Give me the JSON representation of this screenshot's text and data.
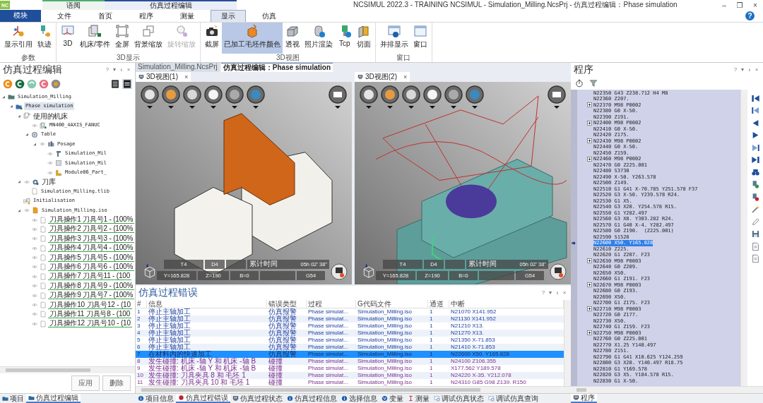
{
  "app": {
    "logo": "NC",
    "title": "NCSIMUL 2022.3 - TRAINING NCSIMUL - Simulation_Milling.NcsPrj - 仿真过程编辑：Phase simulation",
    "controls": [
      "–",
      "❐",
      "×"
    ],
    "help": "?"
  },
  "context_groups": [
    {
      "label": "语阅",
      "color": "#4caf70"
    },
    {
      "label": "仿真过程编辑",
      "color": "#2b4c9b"
    }
  ],
  "module_button": "模块",
  "ribbon_tabs": [
    {
      "label": "文件",
      "selected": false
    },
    {
      "label": "首页",
      "selected": false
    },
    {
      "label": "程序",
      "selected": false
    },
    {
      "label": "测量",
      "selected": false
    },
    {
      "label": "显示",
      "selected": true
    },
    {
      "label": "仿真",
      "selected": false
    }
  ],
  "ribbon_groups": [
    {
      "label": "参数",
      "buttons": [
        {
          "label": "显示引用",
          "kind": "axes",
          "selected": false,
          "disabled": false
        },
        {
          "label": "轨迹",
          "kind": "toolpath",
          "selected": false,
          "disabled": false
        }
      ]
    },
    {
      "label": "3D显示",
      "buttons": [
        {
          "label": "3D",
          "kind": "view3d",
          "selected": false,
          "disabled": false
        },
        {
          "label": "机床/零件",
          "kind": "machine",
          "selected": false,
          "disabled": false
        },
        {
          "label": "全屏",
          "kind": "fullscreen",
          "selected": false,
          "disabled": false
        },
        {
          "label": "背景缩放",
          "kind": "bgzoom",
          "selected": false,
          "disabled": false
        },
        {
          "label": "旋转缩放",
          "kind": "rotzoom",
          "selected": false,
          "disabled": true
        }
      ]
    },
    {
      "label": "3D视图",
      "buttons": [
        {
          "label": "截屏",
          "kind": "camera",
          "selected": false,
          "disabled": false
        },
        {
          "label": "已加工毛坯件颜色",
          "kind": "stockcolor",
          "selected": true,
          "disabled": false
        },
        {
          "label": "透视",
          "kind": "perspective",
          "selected": false,
          "disabled": false
        },
        {
          "label": "照片渲染",
          "kind": "render",
          "selected": false,
          "disabled": false
        },
        {
          "label": "Tcp",
          "kind": "tcp",
          "selected": false,
          "disabled": false
        },
        {
          "label": "切面",
          "kind": "section",
          "selected": false,
          "disabled": false
        }
      ]
    },
    {
      "label": "窗口",
      "buttons": [
        {
          "label": "并排显示",
          "kind": "tile",
          "selected": false,
          "disabled": false
        },
        {
          "label": "窗口",
          "kind": "window",
          "selected": false,
          "disabled": false
        }
      ]
    }
  ],
  "left_pane": {
    "title": "仿真过程编辑",
    "controls": [
      "?",
      "▾",
      "ᵻ",
      "×"
    ],
    "tree": [
      {
        "label": "Simulation_Milling",
        "kind": "folder",
        "eye": false,
        "selected": false,
        "children": [
          {
            "label": "Phase simulation",
            "kind": "phase",
            "eye": false,
            "selected": true,
            "children": [
              {
                "label": "使用的机床",
                "kind": "machines",
                "eye": false,
                "selected": false,
                "children": [
                  {
                    "label": "MN400_4AXIS_FANUC",
                    "kind": "machine",
                    "eye": true,
                    "selected": false
                  },
                  {
                    "label": "Table",
                    "kind": "table",
                    "eye": false,
                    "selected": false,
                    "children": [
                      {
                        "label": "Posage",
                        "kind": "posage",
                        "eye": true,
                        "selected": false,
                        "children": [
                          {
                            "label": "Simulation_Mil",
                            "kind": "fixture",
                            "eye": true,
                            "selected": false
                          },
                          {
                            "label": "Simulation_Mil",
                            "kind": "part",
                            "eye": true,
                            "selected": false
                          },
                          {
                            "label": "Module06_Part_",
                            "kind": "stock",
                            "eye": true,
                            "selected": false
                          }
                        ]
                      }
                    ]
                  }
                ]
              },
              {
                "label": "刀库",
                "kind": "tools",
                "eye": true,
                "selected": false,
                "children": [
                  {
                    "label": "Simulation_Milling.tlib",
                    "kind": "file",
                    "eye": false,
                    "selected": false
                  }
                ]
              },
              {
                "label": "Initialisation",
                "kind": "init",
                "eye": false,
                "selected": false
              },
              {
                "label": "Simulation_Milling.iso",
                "kind": "program",
                "eye": true,
                "selected": false,
                "children": [
                  {
                    "label": "刀具操作1 刀具号1 -  (100%",
                    "kind": "operation",
                    "eye": true,
                    "selected": false
                  },
                  {
                    "label": "刀具操作2 刀具号2 -  (100%",
                    "kind": "operation",
                    "eye": true,
                    "selected": false
                  },
                  {
                    "label": "刀具操作3 刀具号3 -  (100%",
                    "kind": "operation",
                    "eye": true,
                    "selected": false
                  },
                  {
                    "label": "刀具操作4 刀具号4 -  (100%",
                    "kind": "operation",
                    "eye": true,
                    "selected": false
                  },
                  {
                    "label": "刀具操作5 刀具号5 -  (100%",
                    "kind": "operation",
                    "eye": true,
                    "selected": false
                  },
                  {
                    "label": "刀具操作6 刀具号6 -  (100%",
                    "kind": "operation",
                    "eye": true,
                    "selected": false
                  },
                  {
                    "label": "刀具操作7 刀具号11 -  (100",
                    "kind": "operation",
                    "eye": true,
                    "selected": false
                  },
                  {
                    "label": "刀具操作8 刀具号9 -  (100%",
                    "kind": "operation",
                    "eye": true,
                    "selected": false
                  },
                  {
                    "label": "刀具操作9 刀具号7 -  (100%",
                    "kind": "operation",
                    "eye": true,
                    "selected": false
                  },
                  {
                    "label": "刀具操作10 刀具号12 -  (10",
                    "kind": "operation",
                    "eye": true,
                    "selected": false
                  },
                  {
                    "label": "刀具操作11 刀具号8 -  (100",
                    "kind": "operation",
                    "eye": true,
                    "selected": false
                  },
                  {
                    "label": "刀具操作12 刀具号10 -  (10",
                    "kind": "operation",
                    "eye": true,
                    "selected": false
                  }
                ]
              }
            ]
          }
        ]
      }
    ],
    "buttons": [
      "应用",
      "删除"
    ]
  },
  "left_tabs": [
    {
      "label": "项目",
      "selected": false
    },
    {
      "label": "仿真过程编辑",
      "selected": true
    }
  ],
  "doc_tabs": [
    {
      "label": "Simulation_Milling.NcsPrj",
      "selected": false
    },
    {
      "label": "仿真过程编辑：Phase simulation",
      "selected": true
    }
  ],
  "views": [
    {
      "tab": "3D视图(1)",
      "close": "×",
      "tool": "T4",
      "corrector": "D4",
      "time_label": "累计时间",
      "time": "05h 02' 38\"",
      "y": "Y=165.828",
      "z": "Z=190",
      "b": "B=0",
      "offset": "G54"
    },
    {
      "tab": "3D视图(2)",
      "close": "×",
      "tool": "T4",
      "corrector": "D4",
      "time_label": "累计时间",
      "time": "05h 02' 38\"",
      "y": "Y=165.828",
      "z": "Z=190",
      "b": "B=0",
      "offset": "G54"
    }
  ],
  "errors": {
    "title": "仿真过程错误",
    "controls": [
      "?",
      "▾",
      "ᵻ",
      "×"
    ],
    "columns": [
      "#",
      "信息",
      "错误类型",
      "过程",
      "G代码文件",
      "通道",
      "中断"
    ],
    "rows": [
      {
        "cells": [
          "1",
          "停止主轴加工",
          "仿真报警",
          "Phase simulat...",
          "Simulation_Milling.iso",
          "1",
          "N21070 X141.952"
        ],
        "kind": "alarm",
        "selected": false
      },
      {
        "cells": [
          "2",
          "停止主轴加工",
          "仿真报警",
          "Phase simulat...",
          "Simulation_Milling.iso",
          "1",
          "N21130 X141.952"
        ],
        "kind": "alarm",
        "selected": false
      },
      {
        "cells": [
          "3",
          "停止主轴加工",
          "仿真报警",
          "Phase simulat...",
          "Simulation_Milling.iso",
          "1",
          "N21210 X13."
        ],
        "kind": "alarm",
        "selected": false
      },
      {
        "cells": [
          "4",
          "停止主轴加工",
          "仿真报警",
          "Phase simulat...",
          "Simulation_Milling.iso",
          "1",
          "N21270 X13."
        ],
        "kind": "alarm",
        "selected": false
      },
      {
        "cells": [
          "5",
          "停止主轴加工",
          "仿真报警",
          "Phase simulat...",
          "Simulation_Milling.iso",
          "1",
          "N21350 X-71.853"
        ],
        "kind": "alarm",
        "selected": false
      },
      {
        "cells": [
          "6",
          "停止主轴加工",
          "仿真报警",
          "Phase simulat...",
          "Simulation_Milling.iso",
          "1",
          "N21410 X-71.853"
        ],
        "kind": "alarm",
        "selected": false
      },
      {
        "cells": [
          "7",
          "在材料内的快速加工",
          "仿真报警",
          "Phase simulat...",
          "Simulation_Milling.iso",
          "1",
          "N22600 X50. Y165.828"
        ],
        "kind": "alarm",
        "selected": true
      },
      {
        "cells": [
          "8",
          "发生碰撞: 机床 -轴 Y 和 机床 -轴 B",
          "碰撞",
          "Phase simulat...",
          "Simulation_Milling.iso",
          "1",
          "N24100 Z106.355"
        ],
        "kind": "collision",
        "selected": false
      },
      {
        "cells": [
          "9",
          "发生碰撞: 机床 -轴 Y 和 机床 -轴 B",
          "碰撞",
          "Phase simulat...",
          "Simulation_Milling.iso",
          "1",
          "X177.562 Y189.578"
        ],
        "kind": "collision",
        "selected": false
      },
      {
        "cells": [
          "10",
          "发生碰撞: 刀具夹具 8 和 毛坯 1",
          "碰撞",
          "Phase simulat...",
          "Simulation_Milling.iso",
          "1",
          "N24220 X-35. Y212.078"
        ],
        "kind": "collision",
        "selected": false
      },
      {
        "cells": [
          "11",
          "发生碰撞: 刀具夹具 10 和 毛坯 1",
          "碰撞",
          "Phase simulat...",
          "Simulation_Milling.iso",
          "1",
          "N24310 G85 G98 Z139. R150"
        ],
        "kind": "collision",
        "selected": false
      }
    ]
  },
  "bottom_tabs": [
    {
      "label": "项目信息",
      "kind": "info",
      "selected": false
    },
    {
      "label": "仿真过程错误",
      "kind": "error",
      "selected": true
    },
    {
      "label": "仿真过程状态",
      "kind": "state",
      "selected": false
    },
    {
      "label": "仿真过程信息",
      "kind": "info",
      "selected": false
    },
    {
      "label": "选择信息",
      "kind": "info",
      "selected": false
    },
    {
      "label": "变量",
      "kind": "variable",
      "selected": false
    },
    {
      "label": "测量",
      "kind": "measure",
      "selected": false
    },
    {
      "label": "调试仿真状态",
      "kind": "debug",
      "selected": false
    },
    {
      "label": "调试仿真查询",
      "kind": "debug",
      "selected": false
    }
  ],
  "program": {
    "title": "程序",
    "controls": [
      "?",
      "▾",
      "ᵻ",
      "×"
    ],
    "lines": [
      {
        "text": "N22350 G43 Z238.712 H4 M8",
        "kind": "line",
        "selected": false
      },
      {
        "text": "N22360 Z207.",
        "kind": "line",
        "selected": false
      },
      {
        "text": "N22370 M98 P0002",
        "kind": "call",
        "selected": false
      },
      {
        "text": "N22380 G0 X-50.",
        "kind": "line",
        "selected": false
      },
      {
        "text": "N22390 Z191.",
        "kind": "line",
        "selected": false
      },
      {
        "text": "N22400 M98 P0002",
        "kind": "call",
        "selected": false
      },
      {
        "text": "N22410 G0 X-50.",
        "kind": "line",
        "selected": false
      },
      {
        "text": "N22420 Z175.",
        "kind": "line",
        "selected": false
      },
      {
        "text": "N22430 M98 P0002",
        "kind": "call",
        "selected": false
      },
      {
        "text": "N22440 G0 X-50.",
        "kind": "line",
        "selected": false
      },
      {
        "text": "N22450 Z159.",
        "kind": "line",
        "selected": false
      },
      {
        "text": "N22460 M98 P0002",
        "kind": "call",
        "selected": false
      },
      {
        "text": "N22470 G0 Z225.001",
        "kind": "line",
        "selected": false
      },
      {
        "text": "N22480 S3730",
        "kind": "line",
        "selected": false
      },
      {
        "text": "N22490 X-50. Y263.578",
        "kind": "line",
        "selected": false
      },
      {
        "text": "N22500 Z149.",
        "kind": "line",
        "selected": false
      },
      {
        "text": "N22510 G1 G41 X-70.785 Y251.578 F37",
        "kind": "line",
        "selected": false
      },
      {
        "text": "N22520 G3 X-50. Y239.578 R24.",
        "kind": "line",
        "selected": false
      },
      {
        "text": "N22530 G1 X5.",
        "kind": "line",
        "selected": false
      },
      {
        "text": "N22540 G3 X20. Y254.578 R15.",
        "kind": "line",
        "selected": false
      },
      {
        "text": "N22550 G1 Y282.497",
        "kind": "line",
        "selected": false
      },
      {
        "text": "N22560 G3 X8. Y303.282 R24.",
        "kind": "line",
        "selected": false
      },
      {
        "text": "N22570 G1 G40 X-4. Y282.497",
        "kind": "line",
        "selected": false
      },
      {
        "text": "N22580 G0 Z190.  (Z225.001)",
        "kind": "line",
        "selected": false
      },
      {
        "text": "N22590 S1528",
        "kind": "line",
        "selected": false
      },
      {
        "text": "N22600 X50. Y165.828",
        "kind": "line",
        "selected": true
      },
      {
        "text": "N22610 Z225.",
        "kind": "line",
        "selected": false
      },
      {
        "text": "N22620 G1 Z207. F23",
        "kind": "line",
        "selected": false
      },
      {
        "text": "N22630 M98 P0003",
        "kind": "call",
        "selected": false
      },
      {
        "text": "N22640 G0 Z209.",
        "kind": "line",
        "selected": false
      },
      {
        "text": "N22650 X50.",
        "kind": "line",
        "selected": false
      },
      {
        "text": "N22660 G1 Z191. F23",
        "kind": "line",
        "selected": false
      },
      {
        "text": "N22670 M98 P0003",
        "kind": "call",
        "selected": false
      },
      {
        "text": "N22680 G0 Z193.",
        "kind": "line",
        "selected": false
      },
      {
        "text": "N22690 X50.",
        "kind": "line",
        "selected": false
      },
      {
        "text": "N22700 G1 Z175. F23",
        "kind": "line",
        "selected": false
      },
      {
        "text": "N22710 M98 P0003",
        "kind": "call",
        "selected": false
      },
      {
        "text": "N22720 G0 Z177.",
        "kind": "line",
        "selected": false
      },
      {
        "text": "N22730 X50.",
        "kind": "line",
        "selected": false
      },
      {
        "text": "N22740 G1 Z159. F23",
        "kind": "line",
        "selected": false
      },
      {
        "text": "N22750 M98 P0003",
        "kind": "call",
        "selected": false
      },
      {
        "text": "N22760 G0 Z225.001",
        "kind": "line",
        "selected": false
      },
      {
        "text": "N22770 X1.25 Y140.497",
        "kind": "line",
        "selected": false
      },
      {
        "text": "N22780 Z151.",
        "kind": "line",
        "selected": false
      },
      {
        "text": "N22790 G1 G41 X10.625 Y124.259",
        "kind": "line",
        "selected": false
      },
      {
        "text": "N22800 G3 X20. Y140.497 R18.75",
        "kind": "line",
        "selected": false
      },
      {
        "text": "N22810 G1 Y169.578",
        "kind": "line",
        "selected": false
      },
      {
        "text": "N22820 G3 X5. Y184.578 R15.",
        "kind": "line",
        "selected": false
      },
      {
        "text": "N22830 G1 X-50.",
        "kind": "line",
        "selected": false
      }
    ]
  },
  "right_tabs": [
    {
      "label": "程序",
      "selected": true
    }
  ]
}
